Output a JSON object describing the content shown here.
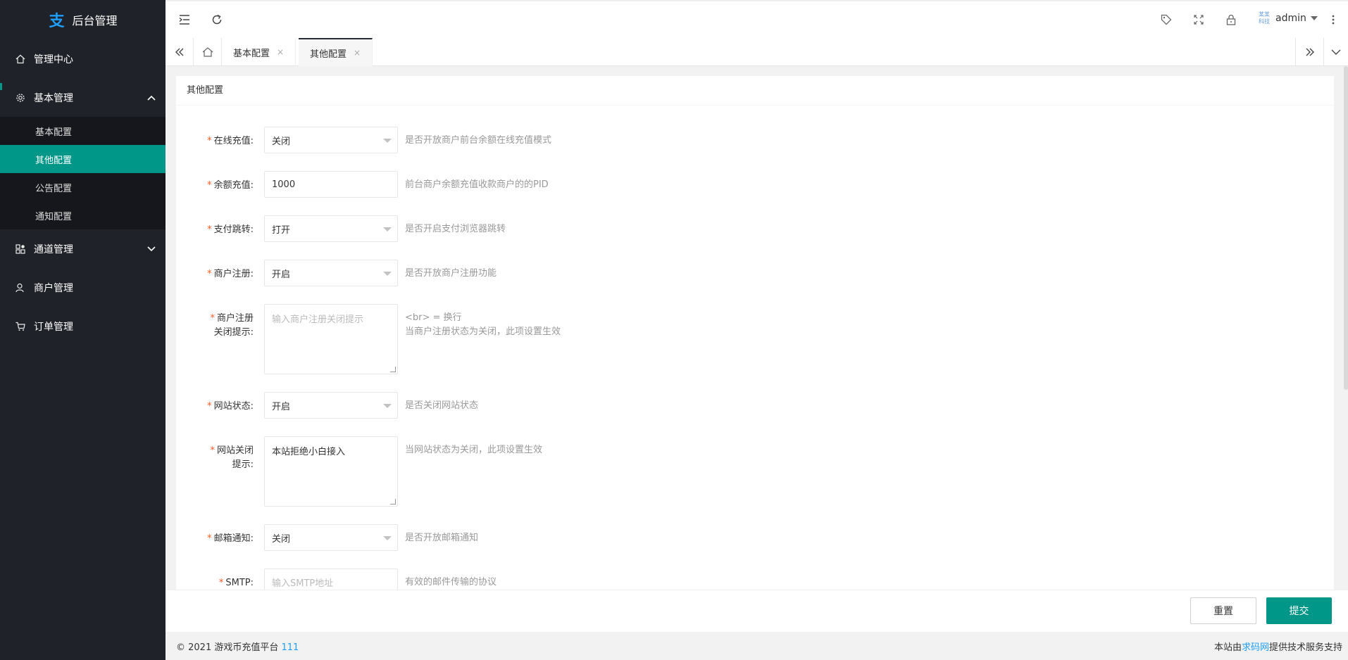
{
  "sidebar": {
    "logo_text": "后台管理",
    "items": [
      {
        "label": "管理中心"
      },
      {
        "label": "基本管理"
      },
      {
        "label": "通道管理"
      },
      {
        "label": "商户管理"
      },
      {
        "label": "订单管理"
      }
    ],
    "sub_items": [
      {
        "label": "基本配置"
      },
      {
        "label": "其他配置"
      },
      {
        "label": "公告配置"
      },
      {
        "label": "通知配置"
      }
    ]
  },
  "header": {
    "user_name": "admin",
    "avatar_text": "某某科技"
  },
  "tabs": [
    {
      "label": "基本配置",
      "close": "×"
    },
    {
      "label": "其他配置",
      "close": "×"
    }
  ],
  "card": {
    "title": "其他配置"
  },
  "form": {
    "online_recharge": {
      "label": "在线充值:",
      "value": "关闭",
      "hint": "是否开放商户前台余额在线充值模式"
    },
    "balance_recharge": {
      "label": "余额充值:",
      "value": "1000",
      "hint": "前台商户余额充值收款商户的的PID"
    },
    "pay_jump": {
      "label": "支付跳转:",
      "value": "打开",
      "hint": "是否开启支付浏览器跳转"
    },
    "merchant_register": {
      "label": "商户注册:",
      "value": "开启",
      "hint": "是否开放商户注册功能"
    },
    "register_closed_tip": {
      "label1": "商户注册",
      "label2": "关闭提示:",
      "placeholder": "输入商户注册关闭提示",
      "hint1": "<br> = 换行",
      "hint2": "当商户注册状态为关闭，此项设置生效"
    },
    "site_status": {
      "label": "网站状态:",
      "value": "开启",
      "hint": "是否关闭网站状态"
    },
    "site_closed_tip": {
      "label1": "网站关闭",
      "label2": "提示:",
      "value": "本站拒绝小白接入",
      "hint": "当网站状态为关闭，此项设置生效"
    },
    "email_notify": {
      "label": "邮箱通知:",
      "value": "关闭",
      "hint": "是否开放邮箱通知"
    },
    "smtp": {
      "label": "SMTP:",
      "placeholder": "输入SMTP地址",
      "hint": "有效的邮件传输的协议"
    },
    "required_mark": "*"
  },
  "buttons": {
    "reset": "重置",
    "submit": "提交"
  },
  "footer": {
    "copyright": "© 2021 游戏币充值平台",
    "link": "111",
    "right_pre": "本站由",
    "right_link": "求码网",
    "right_post": "提供技术服务支持"
  }
}
